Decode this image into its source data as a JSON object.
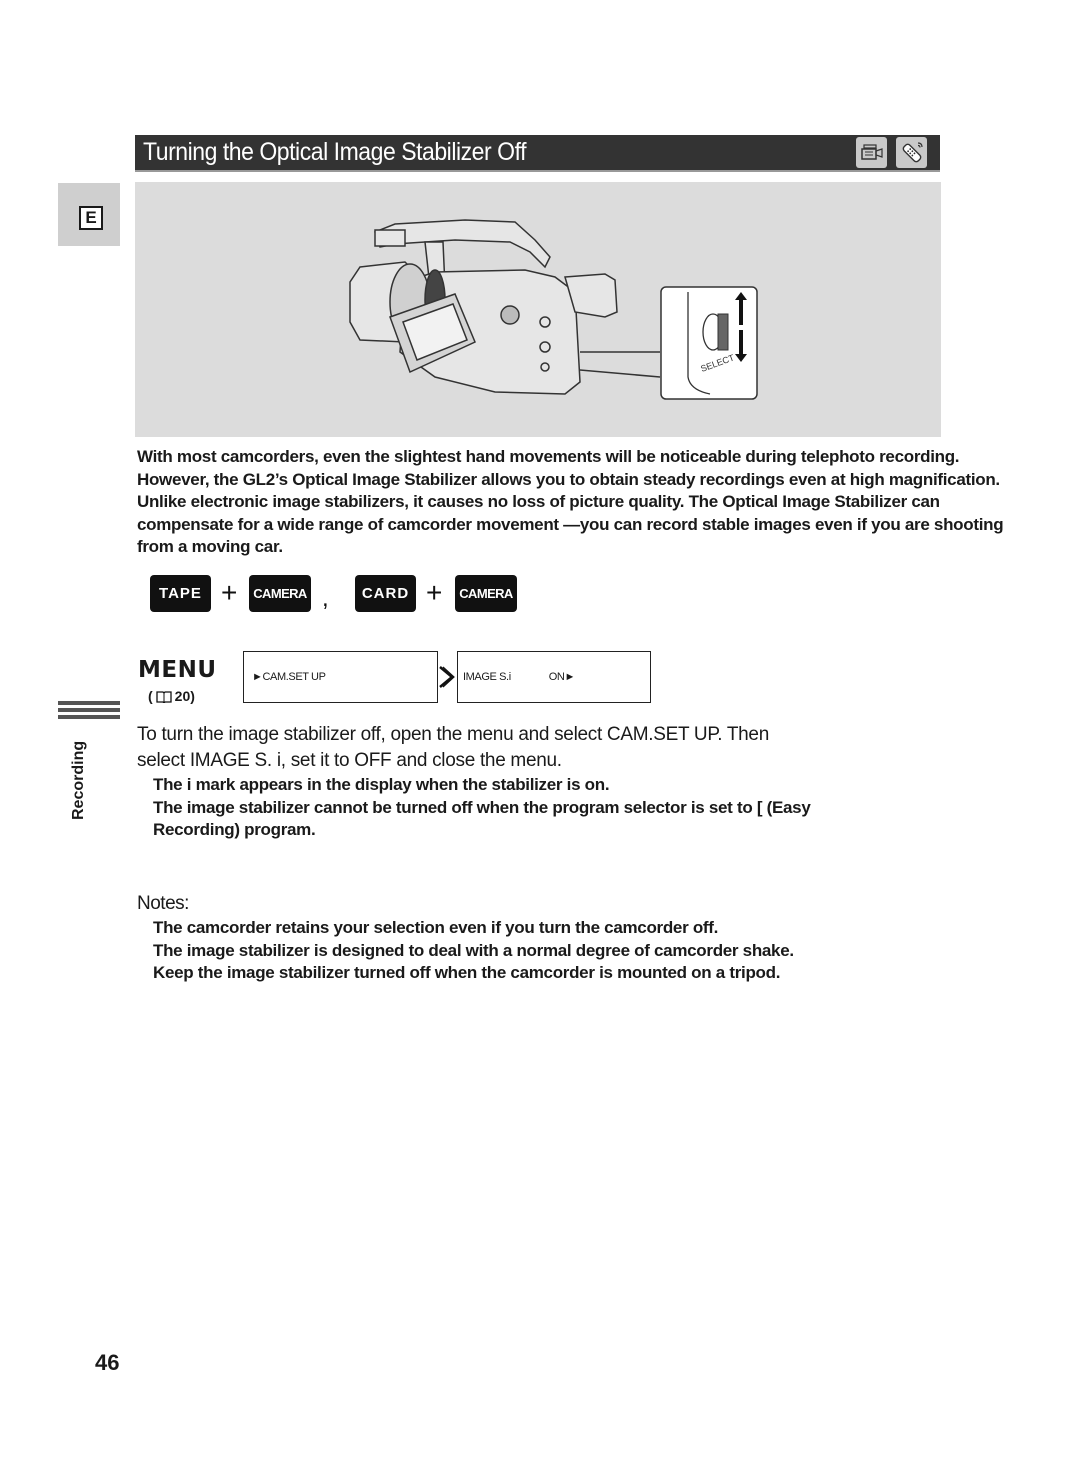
{
  "header": {
    "title": "Turning the Optical Image Stabilizer Off",
    "mode_icons": [
      "camcorder-icon",
      "remote-control-icon"
    ]
  },
  "language_tab": {
    "label": "E"
  },
  "illustration": {
    "description": "Camcorder with inset of SELECT dial and rotation arrows",
    "inset_label": "SELECT"
  },
  "intro": {
    "paragraph": "With most camcorders, even the slightest hand movements will be noticeable during telephoto recording. However, the GL2’s Optical Image Stabilizer allows you to obtain steady recordings even at high magnification. Unlike electronic image stabilizers, it causes no loss of picture quality. The Optical Image Stabilizer can compensate for a wide range of camcorder movement —you can record stable images even if you are shooting from a moving car."
  },
  "modes": {
    "tape": "TAPE",
    "camera": "CAMERA",
    "card": "CARD",
    "plus": "+",
    "comma": ","
  },
  "menu": {
    "label": "MENU",
    "ref_open": "(",
    "ref_page": "20)",
    "step1": "►CAM.SET UP",
    "step2_item": "IMAGE S.i",
    "step2_value": "ON►",
    "arrow": "»"
  },
  "sidebar": {
    "section": "Recording"
  },
  "instructions": {
    "line1": "To turn the image stabilizer off, open the menu and select CAM.SET UP. Then",
    "line2": "select IMAGE S. i, set it to OFF and close the menu.",
    "bullets": [
      "The i    mark appears in the display when the stabilizer is on.",
      "The image stabilizer cannot be turned off when the program selector is set to [ (Easy",
      "Recording) program."
    ]
  },
  "notes": {
    "title": "Notes:",
    "items": [
      "The camcorder retains your selection even if you turn the camcorder off.",
      "The image stabilizer is designed to deal with a normal degree of camcorder shake.",
      "Keep the image stabilizer turned off when the camcorder is mounted on a tripod."
    ]
  },
  "page_number": "46"
}
